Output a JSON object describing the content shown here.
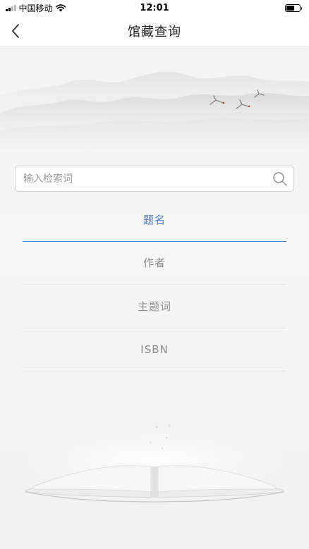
{
  "status_bar": {
    "carrier": "中国移动",
    "time": "12:01",
    "battery_level": 0.6
  },
  "nav": {
    "title": "馆藏查询",
    "back_icon": "chevron-left-icon"
  },
  "search": {
    "value": "",
    "placeholder": "输入检索词",
    "icon": "search-icon"
  },
  "search_types": {
    "selected": "题名",
    "items": [
      {
        "label": "题名"
      },
      {
        "label": "作者"
      },
      {
        "label": "主题词"
      },
      {
        "label": "ISBN"
      }
    ]
  },
  "colors": {
    "accent": "#3d7ad6",
    "inactive_text": "#8b8b8b",
    "divider": "#e3e3e3",
    "background": "#f4f4f4"
  }
}
